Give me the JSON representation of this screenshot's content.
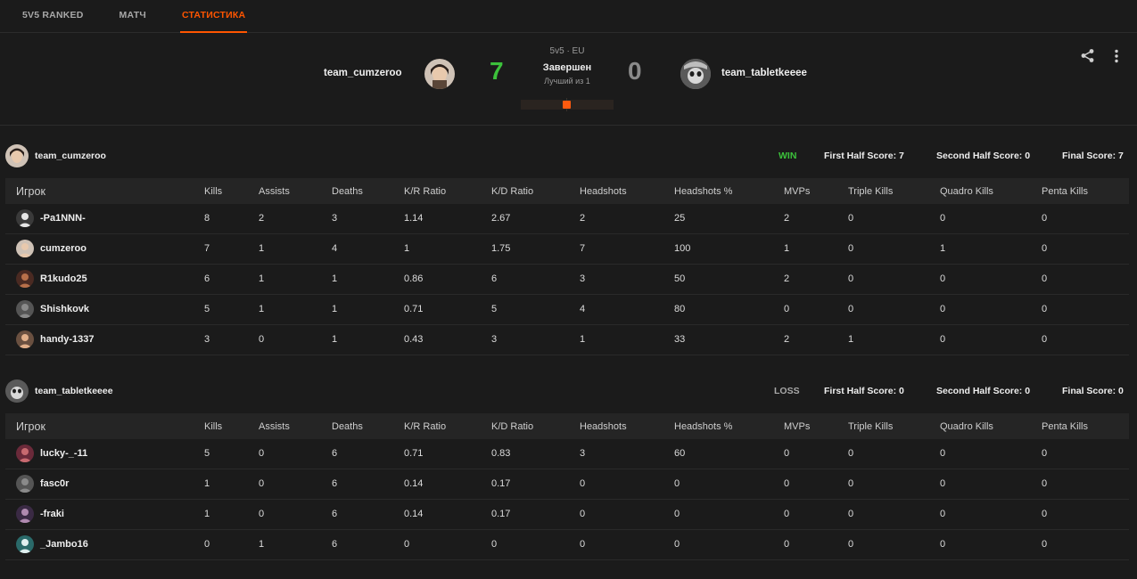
{
  "nav": {
    "tabs": [
      {
        "label": "5V5 RANKED",
        "active": false
      },
      {
        "label": "МАТЧ",
        "active": false
      },
      {
        "label": "СТАТИСТИКА",
        "active": true
      }
    ]
  },
  "match": {
    "mode": "5v5 · EU",
    "status": "Завершен",
    "best_of": "Лучший из 1",
    "team1": {
      "name": "team_cumzeroo",
      "score": "7"
    },
    "team2": {
      "name": "team_tabletkeeee",
      "score": "0"
    }
  },
  "colors": {
    "accent": "#ff5500",
    "win": "#3cc13b",
    "loss": "#8a8a8a",
    "bg": "#1b1b1b"
  },
  "icons": {
    "share": "share-icon",
    "more": "more-vertical-icon"
  },
  "columns": [
    "Игрок",
    "Kills",
    "Assists",
    "Deaths",
    "K/R Ratio",
    "K/D Ratio",
    "Headshots",
    "Headshots %",
    "MVPs",
    "Triple Kills",
    "Quadro Kills",
    "Penta Kills"
  ],
  "teams": [
    {
      "name": "team_cumzeroo",
      "result": "WIN",
      "first_half": "First Half Score: 7",
      "second_half": "Second Half Score: 0",
      "final": "Final Score: 7",
      "players": [
        {
          "name": "-Pa1NNN-",
          "stats": [
            "8",
            "2",
            "3",
            "1.14",
            "2.67",
            "2",
            "25",
            "2",
            "0",
            "0",
            "0"
          ]
        },
        {
          "name": "cumzeroo",
          "stats": [
            "7",
            "1",
            "4",
            "1",
            "1.75",
            "7",
            "100",
            "1",
            "0",
            "1",
            "0"
          ]
        },
        {
          "name": "R1kudo25",
          "stats": [
            "6",
            "1",
            "1",
            "0.86",
            "6",
            "3",
            "50",
            "2",
            "0",
            "0",
            "0"
          ]
        },
        {
          "name": "Shishkovk",
          "stats": [
            "5",
            "1",
            "1",
            "0.71",
            "5",
            "4",
            "80",
            "0",
            "0",
            "0",
            "0"
          ]
        },
        {
          "name": "handy-1337",
          "stats": [
            "3",
            "0",
            "1",
            "0.43",
            "3",
            "1",
            "33",
            "2",
            "1",
            "0",
            "0"
          ]
        }
      ]
    },
    {
      "name": "team_tabletkeeee",
      "result": "LOSS",
      "first_half": "First Half Score: 0",
      "second_half": "Second Half Score: 0",
      "final": "Final Score: 0",
      "players": [
        {
          "name": "lucky-_-11",
          "stats": [
            "5",
            "0",
            "6",
            "0.71",
            "0.83",
            "3",
            "60",
            "0",
            "0",
            "0",
            "0"
          ]
        },
        {
          "name": "fasc0r",
          "stats": [
            "1",
            "0",
            "6",
            "0.14",
            "0.17",
            "0",
            "0",
            "0",
            "0",
            "0",
            "0"
          ]
        },
        {
          "name": "-fraki",
          "stats": [
            "1",
            "0",
            "6",
            "0.14",
            "0.17",
            "0",
            "0",
            "0",
            "0",
            "0",
            "0"
          ]
        },
        {
          "name": "_Jambo16",
          "stats": [
            "0",
            "1",
            "6",
            "0",
            "0",
            "0",
            "0",
            "0",
            "0",
            "0",
            "0"
          ]
        }
      ]
    }
  ]
}
